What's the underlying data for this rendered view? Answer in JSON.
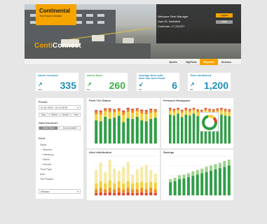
{
  "brand": {
    "logo_name": "Continental",
    "logo_tagline": "The Future in Motion",
    "app_prefix": "Conti",
    "app_suffix": "Connect"
  },
  "welcome": {
    "line1": "Welcome Fleet Manager",
    "line2": "User ID: Northfeld",
    "line3": "Customer: 17-211227",
    "logout_label": "Logout",
    "settings_label": "Tools"
  },
  "nav": [
    {
      "label": "Alerts"
    },
    {
      "label": "MyFleet"
    },
    {
      "label": "Reports",
      "active": true
    },
    {
      "label": "Service"
    }
  ],
  "kpis": [
    {
      "title": "Alerts received",
      "value": "335",
      "period": "10%",
      "arrow": "↗",
      "variant": "blue"
    },
    {
      "title": "Alerts fixed",
      "value": "260",
      "period": "5%",
      "arrow": "↗",
      "variant": "green"
    },
    {
      "title": "Average time until alert has been fixed",
      "value": "6",
      "period": "3%",
      "arrow": "↙",
      "variant": "blue"
    },
    {
      "title": "Tires monitored",
      "value": "1,200",
      "period": "5%",
      "arrow": "↗",
      "variant": "blue2"
    }
  ],
  "filters": {
    "period_label": "Period",
    "period_value": "01.01.2015 - 31.12.2015",
    "period_buttons": [
      "Day",
      "Week",
      "Month",
      "Year"
    ],
    "structure_label": "Data Structure",
    "structure_buttons": [
      "Over Time",
      "Accumulated"
    ],
    "fleet_label": "Fleet",
    "fleet_items": [
      "Depot",
      "+ Bremen",
      "+ Hamburg",
      "+ Berlin",
      "+ Munich",
      "Truck Type",
      "Axle",
      "Tire Position"
    ],
    "select_value": "Monaco"
  },
  "panels": {
    "fleet_status": "Fleet Tire Status",
    "pressure": "Pressure Histogram",
    "alert_dist": "Alert distribution",
    "savings": "Savings"
  },
  "colors": {
    "red": "#d9432f",
    "orange": "#f08a24",
    "yellow": "#f1d13a",
    "lightyellow": "#f6eaa6",
    "green": "#2f9e46",
    "lightgreen": "#9bd28b",
    "accent": "#f5a400",
    "blue": "#1e8fb9"
  },
  "chart_data": [
    {
      "type": "bar",
      "title": "Fleet Tire Status",
      "stacked": true,
      "series": [
        {
          "color": "green",
          "values": [
            52,
            50,
            60,
            55,
            58,
            62,
            48,
            57,
            55,
            60,
            52,
            50,
            55,
            58
          ]
        },
        {
          "color": "yellow",
          "values": [
            14,
            15,
            12,
            15,
            12,
            10,
            16,
            14,
            14,
            12,
            15,
            16,
            14,
            12
          ]
        },
        {
          "color": "orange",
          "values": [
            6,
            6,
            5,
            6,
            5,
            5,
            7,
            6,
            6,
            5,
            6,
            6,
            6,
            5
          ]
        },
        {
          "color": "red",
          "values": [
            3,
            3,
            2,
            3,
            2,
            2,
            3,
            3,
            3,
            2,
            3,
            3,
            3,
            2
          ]
        }
      ]
    },
    {
      "type": "bar",
      "title": "Pressure Histogram",
      "stacked": true,
      "series": [
        {
          "color": "green",
          "values": [
            60,
            58,
            62,
            55,
            60,
            58,
            62,
            57,
            55,
            60,
            58,
            56,
            59,
            60,
            58,
            57
          ]
        },
        {
          "color": "yellow",
          "values": [
            8,
            8,
            7,
            9,
            8,
            8,
            7,
            8,
            9,
            8,
            8,
            9,
            8,
            8,
            8,
            8
          ]
        },
        {
          "color": "orange",
          "values": [
            4,
            4,
            3,
            4,
            4,
            4,
            3,
            4,
            4,
            4,
            4,
            4,
            4,
            4,
            4,
            4
          ]
        },
        {
          "color": "red",
          "values": [
            2,
            2,
            2,
            2,
            2,
            2,
            2,
            2,
            2,
            2,
            2,
            2,
            2,
            2,
            2,
            2
          ]
        }
      ]
    },
    {
      "type": "bar",
      "title": "Alert distribution",
      "stacked": true,
      "series": [
        {
          "color": "red",
          "values": [
            3,
            4,
            3,
            4,
            3,
            4,
            3,
            4,
            3,
            3,
            4,
            3,
            4,
            3
          ]
        },
        {
          "color": "orange",
          "values": [
            5,
            6,
            5,
            6,
            5,
            6,
            5,
            6,
            5,
            5,
            6,
            5,
            6,
            5
          ]
        },
        {
          "color": "yellow",
          "values": [
            8,
            9,
            8,
            10,
            8,
            9,
            8,
            9,
            8,
            9,
            8,
            9,
            8,
            9
          ]
        },
        {
          "color": "lightyellow",
          "values": [
            18,
            25,
            15,
            28,
            20,
            14,
            22,
            26,
            12,
            18,
            20,
            24,
            16,
            12
          ]
        }
      ]
    },
    {
      "type": "bar",
      "title": "Savings",
      "stacked": true,
      "series": [
        {
          "color": "green",
          "values": [
            20,
            22,
            25,
            26,
            28,
            30,
            32,
            34,
            36,
            38,
            40,
            42,
            44,
            46
          ]
        },
        {
          "color": "lightgreen",
          "values": [
            5,
            5,
            6,
            6,
            6,
            7,
            7,
            7,
            8,
            8,
            8,
            8,
            9,
            9
          ]
        }
      ]
    }
  ]
}
